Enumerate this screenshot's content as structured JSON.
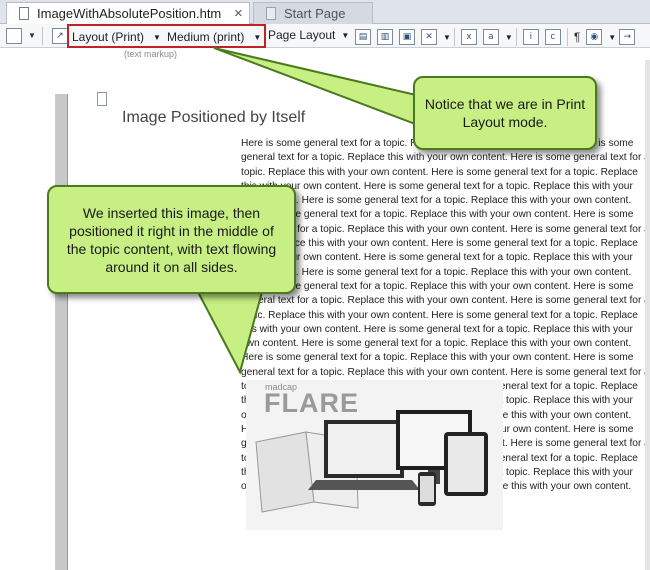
{
  "tabs": [
    {
      "label": "ImageWithAbsolutePosition.htm",
      "close": "✕"
    },
    {
      "label": "Start Page"
    }
  ],
  "toolbar": {
    "layout_label": "Layout (Print)",
    "size_label": "Medium (print)",
    "page_layout_label": "Page Layout",
    "pilcrow": "¶"
  },
  "subtext": "(text markup)",
  "topic": {
    "title": "Image Positioned by Itself",
    "body": "Here is some general text for a topic. Replace this with your own content. Here is some general text for a topic. Replace this with your own content. Here is some general text for a topic. Replace this with your own content. Here is some general text for a topic. Replace this with your own content. Here is some general text for a topic. Replace this with your own content. Here is some general text for a topic. Replace this with your own content. Here is some general text for a topic. Replace this with your own content. Here is some general text for a topic. Replace this with your own content. Here is some general text for a topic. Replace this with your own content. Here is some general text for a topic. Replace this with your own content. Here is some general text for a topic. Replace this with your own content. Here is some general text for a topic. Replace this with your own content. Here is some general text for a topic. Replace this with your own content. Here is some general text for a topic. Replace this with your own content. Here is some general text for a topic. Replace this with your own content. Here is some general text for a topic. Replace this with your own content. Here is some general text for a topic. Replace this with your own content. Here is some general text for a topic. Replace this with your own content. Here is some general text for a topic. Replace this with your own content. Here is some general text for a topic. Replace this with your own content. Here is some general text for a topic. Replace this with your own content. Here is some general text for a topic. Replace this with your own content. Here is some general text for a topic. Replace this with your own content. Here is some general text for a topic. Replace this with your own content. Here is some general text for a topic. Replace this with your own content. Here is some general text for a topic. Replace this with your own content. Here is some general text for a topic. Replace this with your own content. Here is some general text for a topic. Replace this with your own content. Here is some general text for a topic. Replace this with your own content. Here is some general text for a topic. Replace this with your own content."
  },
  "image": {
    "brand_small": "madcap",
    "brand_large": "FLARE"
  },
  "callouts": {
    "print_layout": "Notice that we are in Print Layout mode.",
    "image_note": "We inserted this image, then positioned it right in the middle of the topic content, with text flowing around it on all sides."
  },
  "colors": {
    "callout_fill": "#c7ef84",
    "callout_border": "#4a7a1d",
    "highlight_border": "#c0222a"
  }
}
